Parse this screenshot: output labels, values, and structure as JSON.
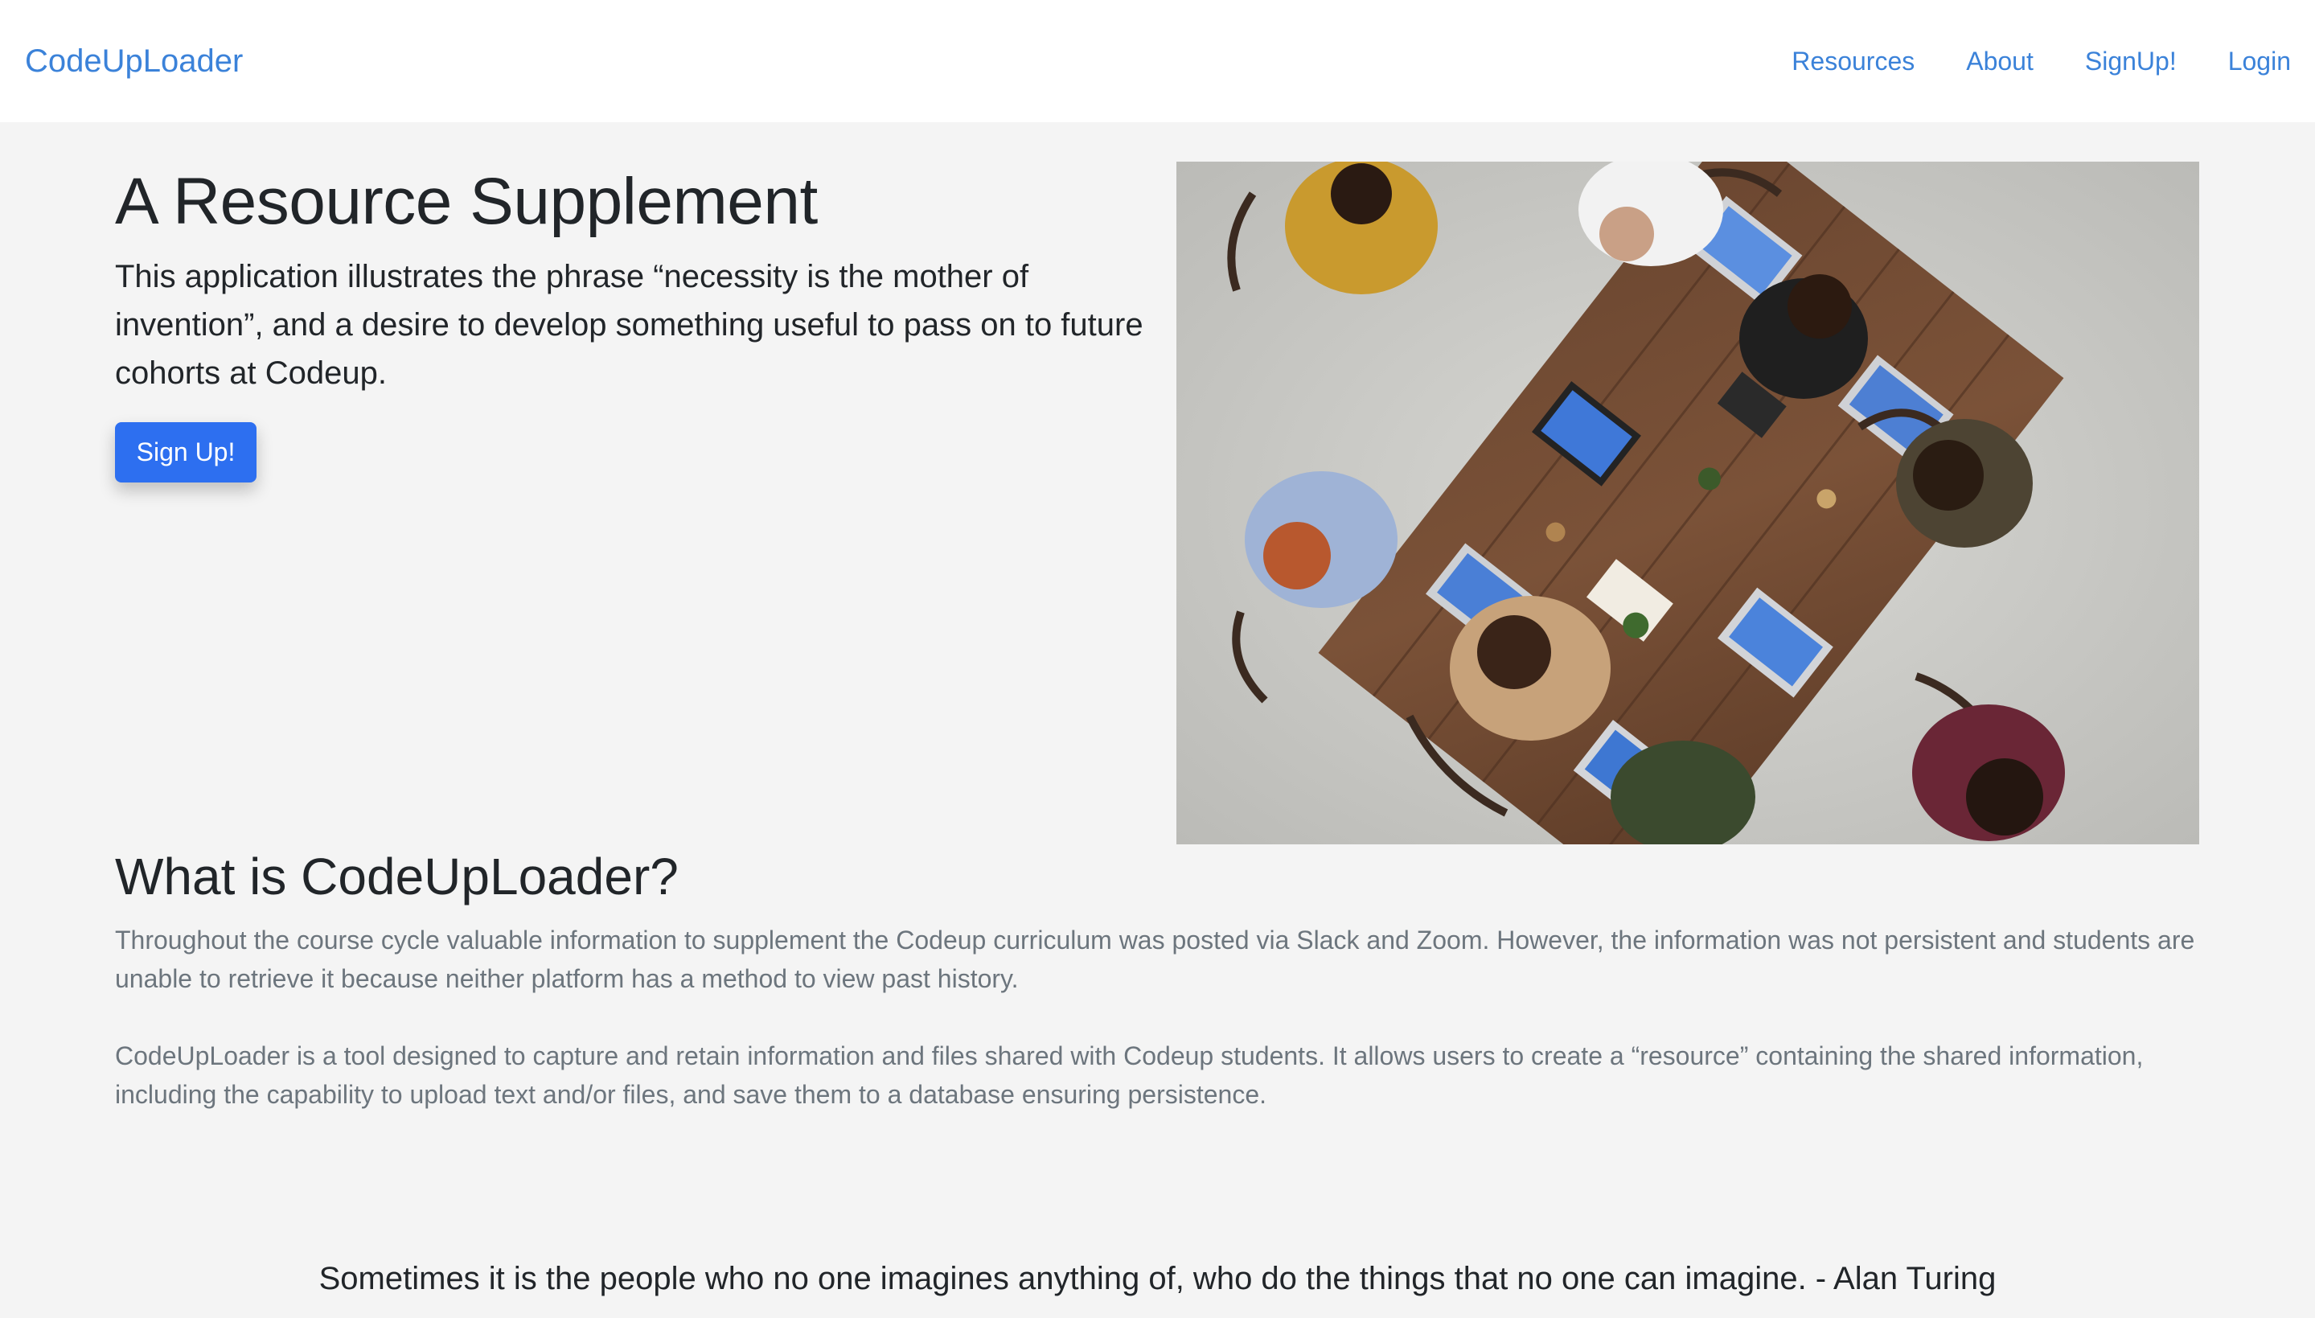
{
  "navbar": {
    "brand": "CodeUpLoader",
    "links": [
      "Resources",
      "About",
      "SignUp!",
      "Login"
    ]
  },
  "hero": {
    "title": "A Resource Supplement",
    "lead": "This application illustrates the phrase “necessity is the mother of invention”, and a desire to develop something useful to pass on to future cohorts at Codeup.",
    "signup_label": "Sign Up!",
    "image_subject": "top-down photo of a team meeting around a wooden table with laptops"
  },
  "about": {
    "title": "What is CodeUpLoader?",
    "paragraph_1": "Throughout the course cycle valuable information to supplement the Codeup curriculum was posted via Slack and Zoom. However, the information was not persistent and students are unable to retrieve it because neither platform has a method to view past history.",
    "paragraph_2": "CodeUpLoader is a tool designed to capture and retain information and files shared with Codeup students. It allows users to create a “resource” containing the shared information, including the capability to upload text and/or files, and save them to a database ensuring persistence."
  },
  "quote": "Sometimes it is the people who no one imagines anything of, who do the things that no one can imagine. - Alan Turing",
  "colors": {
    "link": "#3b82d9",
    "primary_button": "#2d6ff0",
    "page_background": "#f4f4f4"
  }
}
